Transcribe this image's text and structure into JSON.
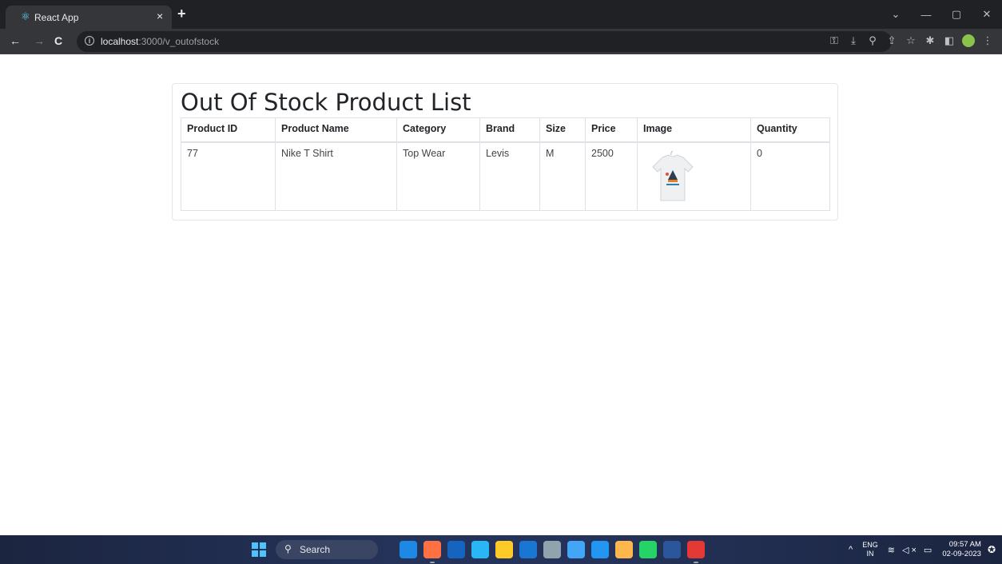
{
  "browser": {
    "tab": {
      "title": "React App",
      "favicon": "react-icon",
      "close": "×"
    },
    "new_tab": "+",
    "window_controls": [
      "⌄",
      "—",
      "▢",
      "✕"
    ],
    "nav": {
      "back": "←",
      "forward": "→",
      "reload": "C"
    },
    "url_host": "localhost",
    "url_path": ":3000/v_outofstock",
    "toolbar_icons": [
      "key-icon",
      "install-icon",
      "zoom-icon",
      "share-icon",
      "star-icon",
      "extensions-icon",
      "sidepanel-icon",
      "profile-avatar",
      "menu-icon"
    ]
  },
  "page": {
    "title": "Out Of Stock Product List",
    "table": {
      "headers": [
        "Product ID",
        "Product Name",
        "Category",
        "Brand",
        "Size",
        "Price",
        "Image",
        "Quantity"
      ],
      "rows": [
        {
          "id": "77",
          "name": "Nike T Shirt",
          "category": "Top Wear",
          "brand": "Levis",
          "size": "M",
          "price": "2500",
          "image": "tshirt-image",
          "quantity": "0"
        }
      ]
    }
  },
  "taskbar": {
    "search_label": "Search",
    "apps": [
      "copilot-icon",
      "chrome-icon",
      "store-icon",
      "edge-icon",
      "files-icon",
      "l-app-icon",
      "settings-icon",
      "monitor-icon",
      "vscode-icon",
      "gear-app-icon",
      "whatsapp-icon",
      "word-icon",
      "paint-icon"
    ],
    "colors": [
      "#1e88e5",
      "#ff7043",
      "#1565c0",
      "#29b6f6",
      "#ffca28",
      "#1976d2",
      "#90a4ae",
      "#42a5f5",
      "#2196f3",
      "#ffb74d",
      "#25d366",
      "#2b579a",
      "#e53935"
    ],
    "tray": {
      "caret": "^",
      "lang_line1": "ENG",
      "lang_line2": "IN",
      "time": "09:57 AM",
      "date": "02-09-2023"
    }
  }
}
